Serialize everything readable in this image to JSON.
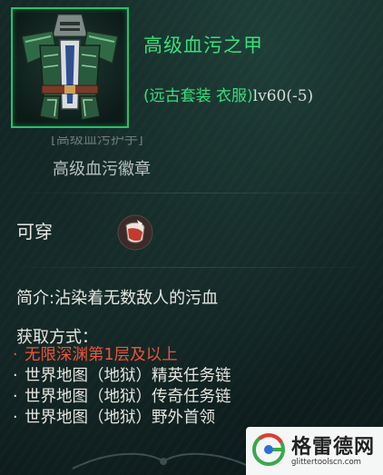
{
  "item": {
    "name": "高级血污之甲",
    "set_type": "(远古套装 衣服)",
    "level": "lv60(-5)",
    "icon": "armor-chestplate-icon",
    "rarity_color": "#36e07a"
  },
  "partial_line": "[高级血污护手]",
  "badge_name": "高级血污徽章",
  "wearable_label": "可穿",
  "wearable_icon": "cloth-wearable-icon",
  "description": "简介:沾染着无数敌人的污血",
  "obtain": {
    "title": "获取方式：",
    "items": [
      {
        "bullet": "·",
        "text": "无限深渊第1层及以上",
        "color": "#f1533a"
      },
      {
        "bullet": "·",
        "text": "世界地图（地狱）精英任务链",
        "color": "#e6e6e0"
      },
      {
        "bullet": "·",
        "text": "世界地图（地狱）传奇任务链",
        "color": "#e6e6e0"
      },
      {
        "bullet": "·",
        "text": "世界地图（地狱）野外首领",
        "color": "#e6e6e0"
      }
    ]
  },
  "watermark": {
    "title": "格雷德网",
    "url": "glittertoolscn.com"
  }
}
